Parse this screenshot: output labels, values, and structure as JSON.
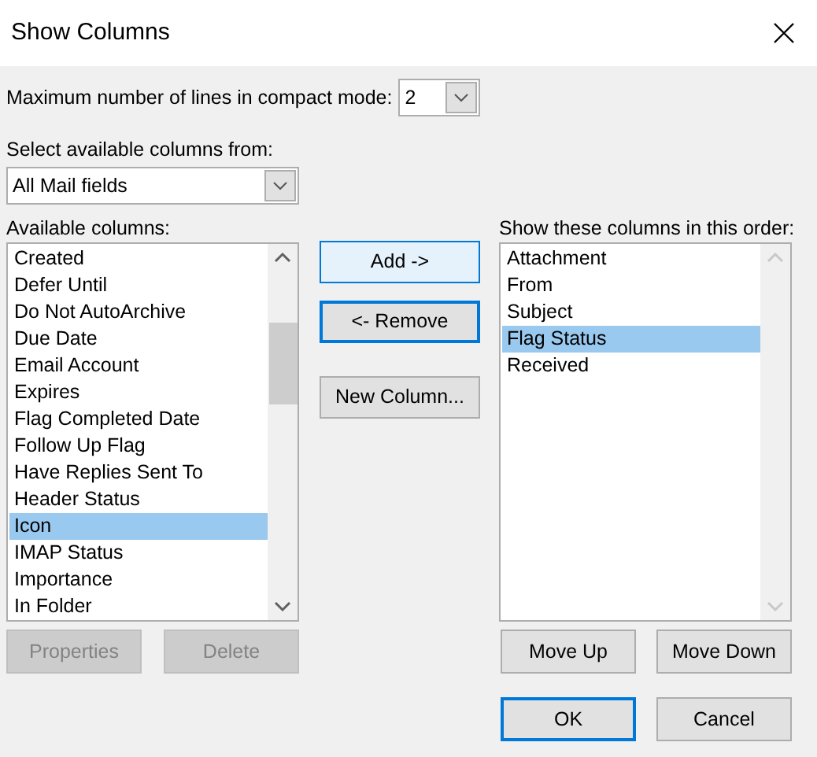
{
  "window": {
    "title": "Show Columns"
  },
  "compact_lines": {
    "label": "Maximum number of lines in compact mode:",
    "value": "2"
  },
  "source": {
    "label": "Select available columns from:",
    "value": "All Mail fields"
  },
  "available": {
    "label": "Available columns:",
    "items": [
      {
        "text": "Created",
        "selected": false
      },
      {
        "text": "Defer Until",
        "selected": false
      },
      {
        "text": "Do Not AutoArchive",
        "selected": false
      },
      {
        "text": "Due Date",
        "selected": false
      },
      {
        "text": "Email Account",
        "selected": false
      },
      {
        "text": "Expires",
        "selected": false
      },
      {
        "text": "Flag Completed Date",
        "selected": false
      },
      {
        "text": "Follow Up Flag",
        "selected": false
      },
      {
        "text": "Have Replies Sent To",
        "selected": false
      },
      {
        "text": "Header Status",
        "selected": false
      },
      {
        "text": "Icon",
        "selected": true
      },
      {
        "text": "IMAP Status",
        "selected": false
      },
      {
        "text": "Importance",
        "selected": false
      },
      {
        "text": "In Folder",
        "selected": false
      }
    ],
    "buttons": [
      {
        "label": "Properties",
        "disabled": true,
        "hovered": false,
        "focused": false
      },
      {
        "label": "Delete",
        "disabled": true,
        "hovered": false,
        "focused": false
      }
    ]
  },
  "middle_buttons": [
    {
      "label": "Add ->",
      "disabled": false,
      "hovered": true,
      "focused": false
    },
    {
      "label": "<- Remove",
      "disabled": false,
      "hovered": false,
      "focused": true
    },
    {
      "label": "New Column...",
      "disabled": false,
      "hovered": false,
      "focused": false
    }
  ],
  "shown": {
    "label": "Show these columns in this order:",
    "items": [
      {
        "text": "Attachment",
        "selected": false
      },
      {
        "text": "From",
        "selected": false
      },
      {
        "text": "Subject",
        "selected": false
      },
      {
        "text": "Flag Status",
        "selected": true
      },
      {
        "text": "Received",
        "selected": false
      }
    ],
    "buttons": [
      {
        "label": "Move Up",
        "disabled": false,
        "hovered": false,
        "focused": false
      },
      {
        "label": "Move Down",
        "disabled": false,
        "hovered": false,
        "focused": false
      }
    ]
  },
  "footer_buttons": [
    {
      "label": "OK",
      "disabled": false,
      "hovered": false,
      "focused": true
    },
    {
      "label": "Cancel",
      "disabled": false,
      "hovered": false,
      "focused": false
    }
  ]
}
